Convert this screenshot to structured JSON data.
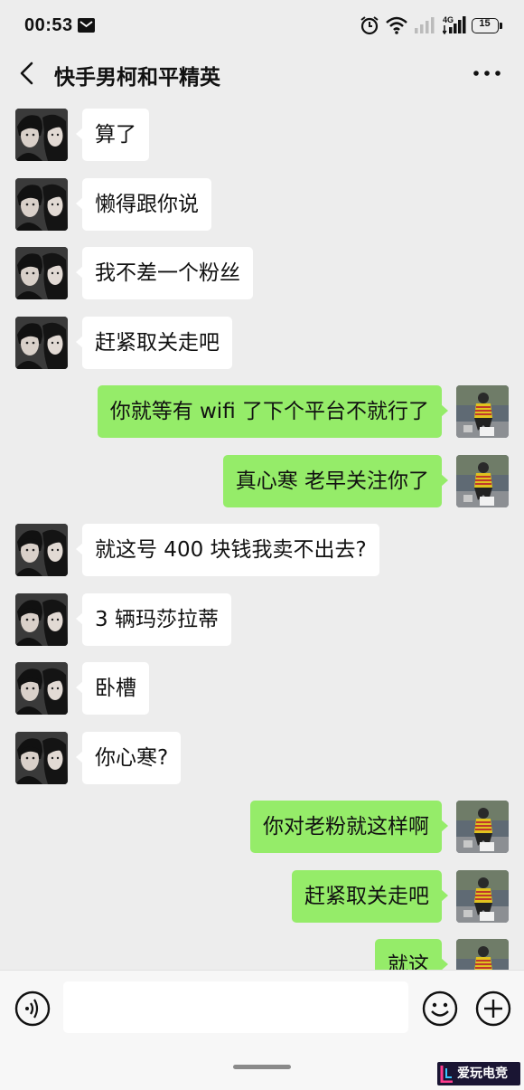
{
  "status_bar": {
    "time": "00:53",
    "network_label": "4G",
    "battery": "15"
  },
  "header": {
    "title": "快手男柯和平精英"
  },
  "messages": [
    {
      "side": "left",
      "text": "算了"
    },
    {
      "side": "left",
      "text": "懒得跟你说"
    },
    {
      "side": "left",
      "text": "我不差一个粉丝"
    },
    {
      "side": "left",
      "text": "赶紧取关走吧"
    },
    {
      "side": "right",
      "text": "你就等有 wifi 了下个平台不就行了"
    },
    {
      "side": "right",
      "text": "真心寒 老早关注你了"
    },
    {
      "side": "left",
      "text": "就这号 400 块钱我卖不出去?"
    },
    {
      "side": "left",
      "text": "3 辆玛莎拉蒂"
    },
    {
      "side": "left",
      "text": "卧槽"
    },
    {
      "side": "left",
      "text": "你心寒?"
    },
    {
      "side": "right",
      "text": "你对老粉就这样啊"
    },
    {
      "side": "right",
      "text": "赶紧取关走吧"
    },
    {
      "side": "right",
      "text": "就这"
    }
  ],
  "input_bar": {
    "text_value": "",
    "icons": [
      "voice-icon",
      "emoji-icon",
      "plus-icon"
    ]
  },
  "watermark": {
    "text": "爱玩电竞"
  },
  "colors": {
    "background": "#ededed",
    "bubble_self": "#95ec69",
    "bubble_other": "#ffffff"
  }
}
